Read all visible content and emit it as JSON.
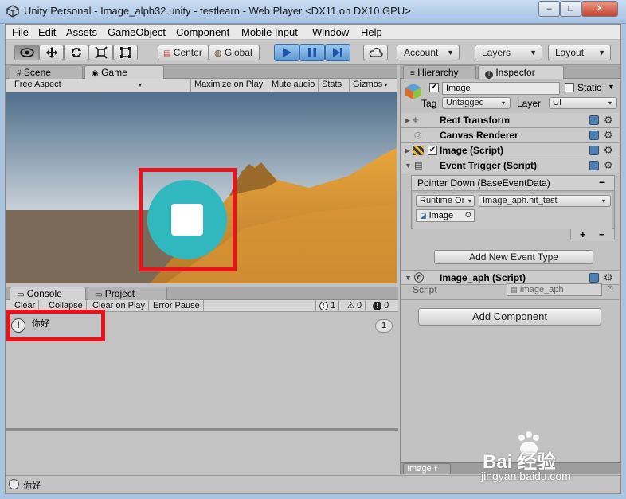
{
  "window": {
    "title": "Unity Personal - Image_alph32.unity - testlearn - Web Player <DX11 on DX10 GPU>",
    "minimize": "–",
    "maximize": "□",
    "close": "✕"
  },
  "menu": [
    "File",
    "Edit",
    "Assets",
    "GameObject",
    "Component",
    "Mobile Input",
    "Window",
    "Help"
  ],
  "toolbar": {
    "center": "Center",
    "global": "Global",
    "account": "Account",
    "layers": "Layers",
    "layout": "Layout"
  },
  "tabs": {
    "scene": "Scene",
    "game": "Game",
    "hierarchy": "Hierarchy",
    "inspector": "Inspector",
    "console": "Console",
    "project": "Project"
  },
  "game": {
    "aspect": "Free Aspect",
    "maximize": "Maximize on Play",
    "mute": "Mute audio",
    "stats": "Stats",
    "gizmos": "Gizmos"
  },
  "console": {
    "clear": "Clear",
    "collapse": "Collapse",
    "clear_on_play": "Clear on Play",
    "error_pause": "Error Pause",
    "info_count": "1",
    "warn_count": "0",
    "error_count": "0",
    "message": "你好",
    "message_count": "1"
  },
  "status": {
    "message": "你好"
  },
  "inspector": {
    "name": "Image",
    "static": "Static",
    "tag_label": "Tag",
    "tag": "Untagged",
    "layer_label": "Layer",
    "layer": "UI",
    "components": {
      "rect": "Rect Transform",
      "canvas": "Canvas Renderer",
      "image": "Image (Script)",
      "event": "Event Trigger (Script)",
      "aph": "Image_aph (Script)"
    },
    "event": {
      "entry": "Pointer Down (BaseEventData)",
      "mode": "Runtime Or",
      "function": "Image_aph.hit_test",
      "object": "Image",
      "add_type": "Add New Event Type"
    },
    "script_label": "Script",
    "script_value": "Image_aph",
    "add_component": "Add Component",
    "footer": "Image"
  },
  "watermark": {
    "brand": "Bai 经验",
    "url": "jingyan.baidu.com"
  },
  "colors": {
    "highlight": "#e8141c",
    "button_fill": "#31b8bf",
    "play": "#5f9ad3"
  }
}
